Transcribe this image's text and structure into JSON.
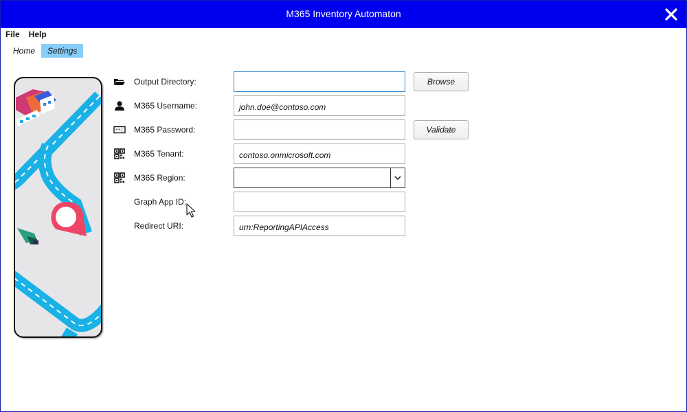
{
  "window": {
    "title": "M365 Inventory Automaton"
  },
  "menu": {
    "file": "File",
    "help": "Help"
  },
  "tabs": [
    {
      "label": "Home",
      "active": false
    },
    {
      "label": "Settings",
      "active": true
    }
  ],
  "form": {
    "output_directory": {
      "label": "Output Directory:",
      "value": "",
      "icon": "folder-icon"
    },
    "username": {
      "label": "M365 Username:",
      "value": "john.doe@contoso.com",
      "icon": "user-icon"
    },
    "password": {
      "label": "M365 Password:",
      "value": "",
      "icon": "password-icon"
    },
    "tenant": {
      "label": "M365 Tenant:",
      "value": "contoso.onmicrosoft.com",
      "icon": "qr-icon"
    },
    "region": {
      "label": "M365 Region:",
      "value": "",
      "icon": "qr-icon"
    },
    "graph_app_id": {
      "label": "Graph App ID:",
      "value": ""
    },
    "redirect_uri": {
      "label": "Redirect URI:",
      "value": "urn:ReportingAPIAccess"
    }
  },
  "buttons": {
    "browse": "Browse",
    "validate": "Validate"
  },
  "colors": {
    "titlebar": "#0000ee",
    "active_tab": "#87cdf7",
    "road": "#1ab2e6",
    "pin": "#ee4466"
  }
}
